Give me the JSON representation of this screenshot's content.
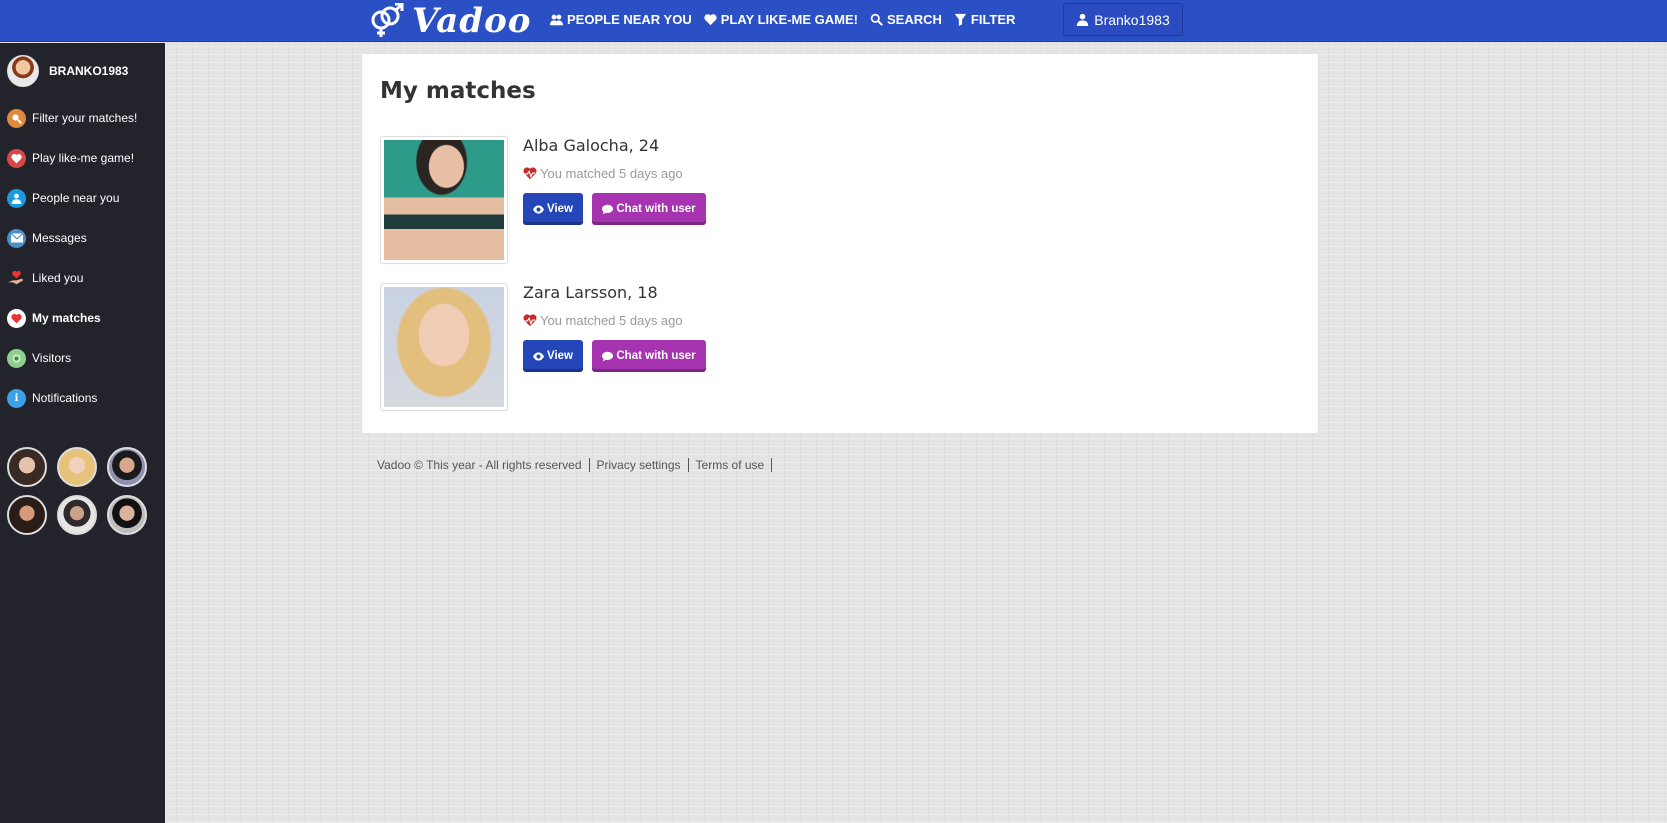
{
  "header": {
    "logo_text": "Vadoo",
    "nav": [
      {
        "label": "PEOPLE NEAR YOU",
        "icon": "users-icon"
      },
      {
        "label": "PLAY LIKE-ME GAME!",
        "icon": "heart-icon"
      },
      {
        "label": "SEARCH",
        "icon": "search-icon"
      },
      {
        "label": "FILTER",
        "icon": "filter-icon"
      }
    ],
    "user_button": "Branko1983"
  },
  "sidebar": {
    "username": "BRANKO1983",
    "items": [
      {
        "label": "Filter your matches!",
        "icon": "magnifier-icon",
        "color": "#e08a3c"
      },
      {
        "label": "Play like-me game!",
        "icon": "heart-icon",
        "color": "#d94747"
      },
      {
        "label": "People near you",
        "icon": "person-icon",
        "color": "#1a9be0"
      },
      {
        "label": "Messages",
        "icon": "envelope-icon",
        "color": "#4a90c8"
      },
      {
        "label": "Liked you",
        "icon": "hand-heart-icon",
        "color": "#e35a6a"
      },
      {
        "label": "My matches",
        "icon": "heart-icon",
        "color": "#e33"
      },
      {
        "label": "Visitors",
        "icon": "eye-icon",
        "color": "#5cb85c"
      },
      {
        "label": "Notifications",
        "icon": "info-icon",
        "color": "#3aa0e8"
      }
    ],
    "active_item": "My matches"
  },
  "main": {
    "title": "My matches",
    "matches": [
      {
        "name": "Alba Galocha, 24",
        "matched_text": "You matched 5 days ago",
        "view_label": "View",
        "chat_label": "Chat with user"
      },
      {
        "name": "Zara Larsson, 18",
        "matched_text": "You matched 5 days ago",
        "view_label": "View",
        "chat_label": "Chat with user"
      }
    ]
  },
  "footer": {
    "copyright": "Vadoo © This year - All rights reserved",
    "links": [
      "Privacy settings",
      "Terms of use"
    ]
  },
  "colors": {
    "header_bg": "#2b4fc4",
    "sidebar_bg": "#22232b",
    "view_button": "#2546b8",
    "chat_button": "#a633b0"
  }
}
